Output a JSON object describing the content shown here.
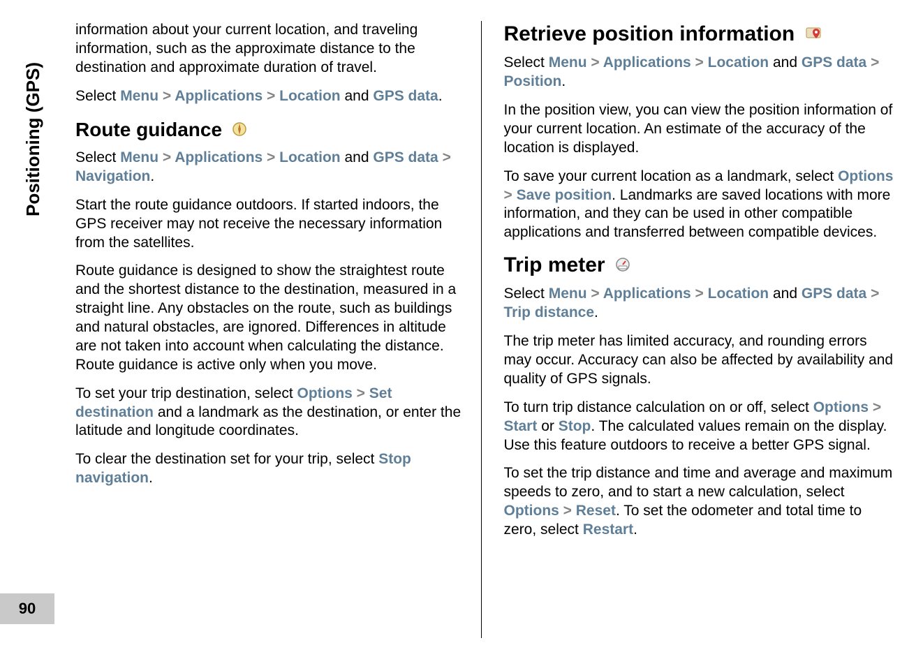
{
  "sideTab": "Positioning (GPS)",
  "pageNumber": "90",
  "sep": " > ",
  "and": " and ",
  "period": ".",
  "or": " or ",
  "left": {
    "introPara": "information about your current location, and traveling information, such as the approximate distance to the destination and approximate duration of travel.",
    "selectWord": "Select ",
    "nav1": {
      "menu": "Menu",
      "apps": "Applications",
      "loc": "Location",
      "gps": "GPS data"
    },
    "routeGuidanceHeading": "Route guidance",
    "nav2": {
      "menu": "Menu",
      "apps": "Applications",
      "loc": "Location",
      "gps": "GPS data",
      "navItem": "Navigation"
    },
    "para2": "Start the route guidance outdoors. If started indoors, the GPS receiver may not receive the necessary information from the satellites.",
    "para3": "Route guidance is designed to show the straightest route and the shortest distance to the destination, measured in a straight line. Any obstacles on the route, such as buildings and natural obstacles, are ignored. Differences in altitude are not taken into account when calculating the distance. Route guidance is active only when you move.",
    "para4a": "To set your trip destination, select ",
    "para4Options": "Options",
    "para4Set": "Set destination",
    "para4b": " and a landmark as the destination, or enter the latitude and longitude coordinates.",
    "para5a": "To clear the destination set for your trip, select ",
    "para5Stop": "Stop navigation"
  },
  "right": {
    "retrieveHeading": "Retrieve position information",
    "selectWord": "Select ",
    "nav1": {
      "menu": "Menu",
      "apps": "Applications",
      "loc": "Location",
      "gps": "GPS data",
      "pos": "Position"
    },
    "para1": "In the position view, you can view the position information of your current location. An estimate of the accuracy of the location is displayed.",
    "para2a": "To save your current location as a landmark, select ",
    "para2Options": "Options",
    "para2Save": "Save position",
    "para2b": ". Landmarks are saved locations with more information, and they can be used in other compatible applications and transferred between compatible devices.",
    "tripHeading": "Trip meter",
    "nav2": {
      "menu": "Menu",
      "apps": "Applications",
      "loc": "Location",
      "gps": "GPS data",
      "trip": "Trip distance"
    },
    "para3": "The trip meter has limited accuracy, and rounding errors may occur. Accuracy can also be affected by availability and quality of GPS signals.",
    "para4a": "To turn trip distance calculation on or off, select ",
    "para4Options": "Options",
    "para4Start": "Start",
    "para4Stop": "Stop",
    "para4b": ". The calculated values remain on the display. Use this feature outdoors to receive a better GPS signal.",
    "para5a": "To set the trip distance and time and average and maximum speeds to zero, and to start a new calculation, select ",
    "para5Options": "Options",
    "para5Reset": "Reset",
    "para5b": ". To set the odometer and total time to zero, select ",
    "para5Restart": "Restart"
  }
}
